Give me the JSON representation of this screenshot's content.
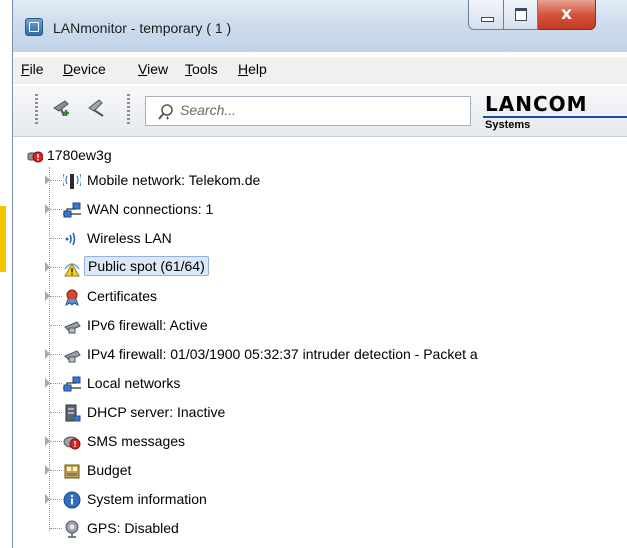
{
  "window": {
    "title": "LANmonitor - temporary ( 1 )",
    "close_glyph": "x"
  },
  "menu": [
    {
      "label": "File",
      "key": "F",
      "rest": "ile"
    },
    {
      "label": "Device",
      "key": "D",
      "rest": "evice"
    },
    {
      "label": "View",
      "key": "V",
      "rest": "iew"
    },
    {
      "label": "Tools",
      "key": "T",
      "rest": "ools"
    },
    {
      "label": "Help",
      "key": "H",
      "rest": "elp"
    }
  ],
  "toolbar": {
    "search_placeholder": "Search...",
    "logo_main": "LANCOM",
    "logo_sub": "Systems",
    "brand_color": "#1a4fa0"
  },
  "tree": {
    "root": {
      "label": "1780ew3g",
      "icon": "router-alert-icon"
    },
    "items": [
      {
        "label": "Mobile network: Telekom.de",
        "icon": "mobile-antenna-icon",
        "expandable": true
      },
      {
        "label": "WAN connections: 1",
        "icon": "network-icon",
        "expandable": true
      },
      {
        "label": "Wireless LAN",
        "icon": "wireless-icon",
        "expandable": false
      },
      {
        "label": "Public spot (61/64)",
        "icon": "public-spot-warning-icon",
        "expandable": true,
        "selected": true
      },
      {
        "label": "Certificates",
        "icon": "certificate-icon",
        "expandable": true
      },
      {
        "label": "IPv6 firewall: Active",
        "icon": "firewall-icon",
        "expandable": false
      },
      {
        "label": "IPv4 firewall: 01/03/1900 05:32:37 intruder detection - Packet a",
        "icon": "firewall-icon",
        "expandable": true
      },
      {
        "label": "Local networks",
        "icon": "network-icon",
        "expandable": true
      },
      {
        "label": "DHCP server: Inactive",
        "icon": "server-icon",
        "expandable": false
      },
      {
        "label": "SMS messages",
        "icon": "sms-icon",
        "expandable": true
      },
      {
        "label": "Budget",
        "icon": "budget-icon",
        "expandable": true
      },
      {
        "label": "System information",
        "icon": "info-icon",
        "expandable": true
      },
      {
        "label": "GPS: Disabled",
        "icon": "gps-icon",
        "expandable": false
      }
    ]
  }
}
